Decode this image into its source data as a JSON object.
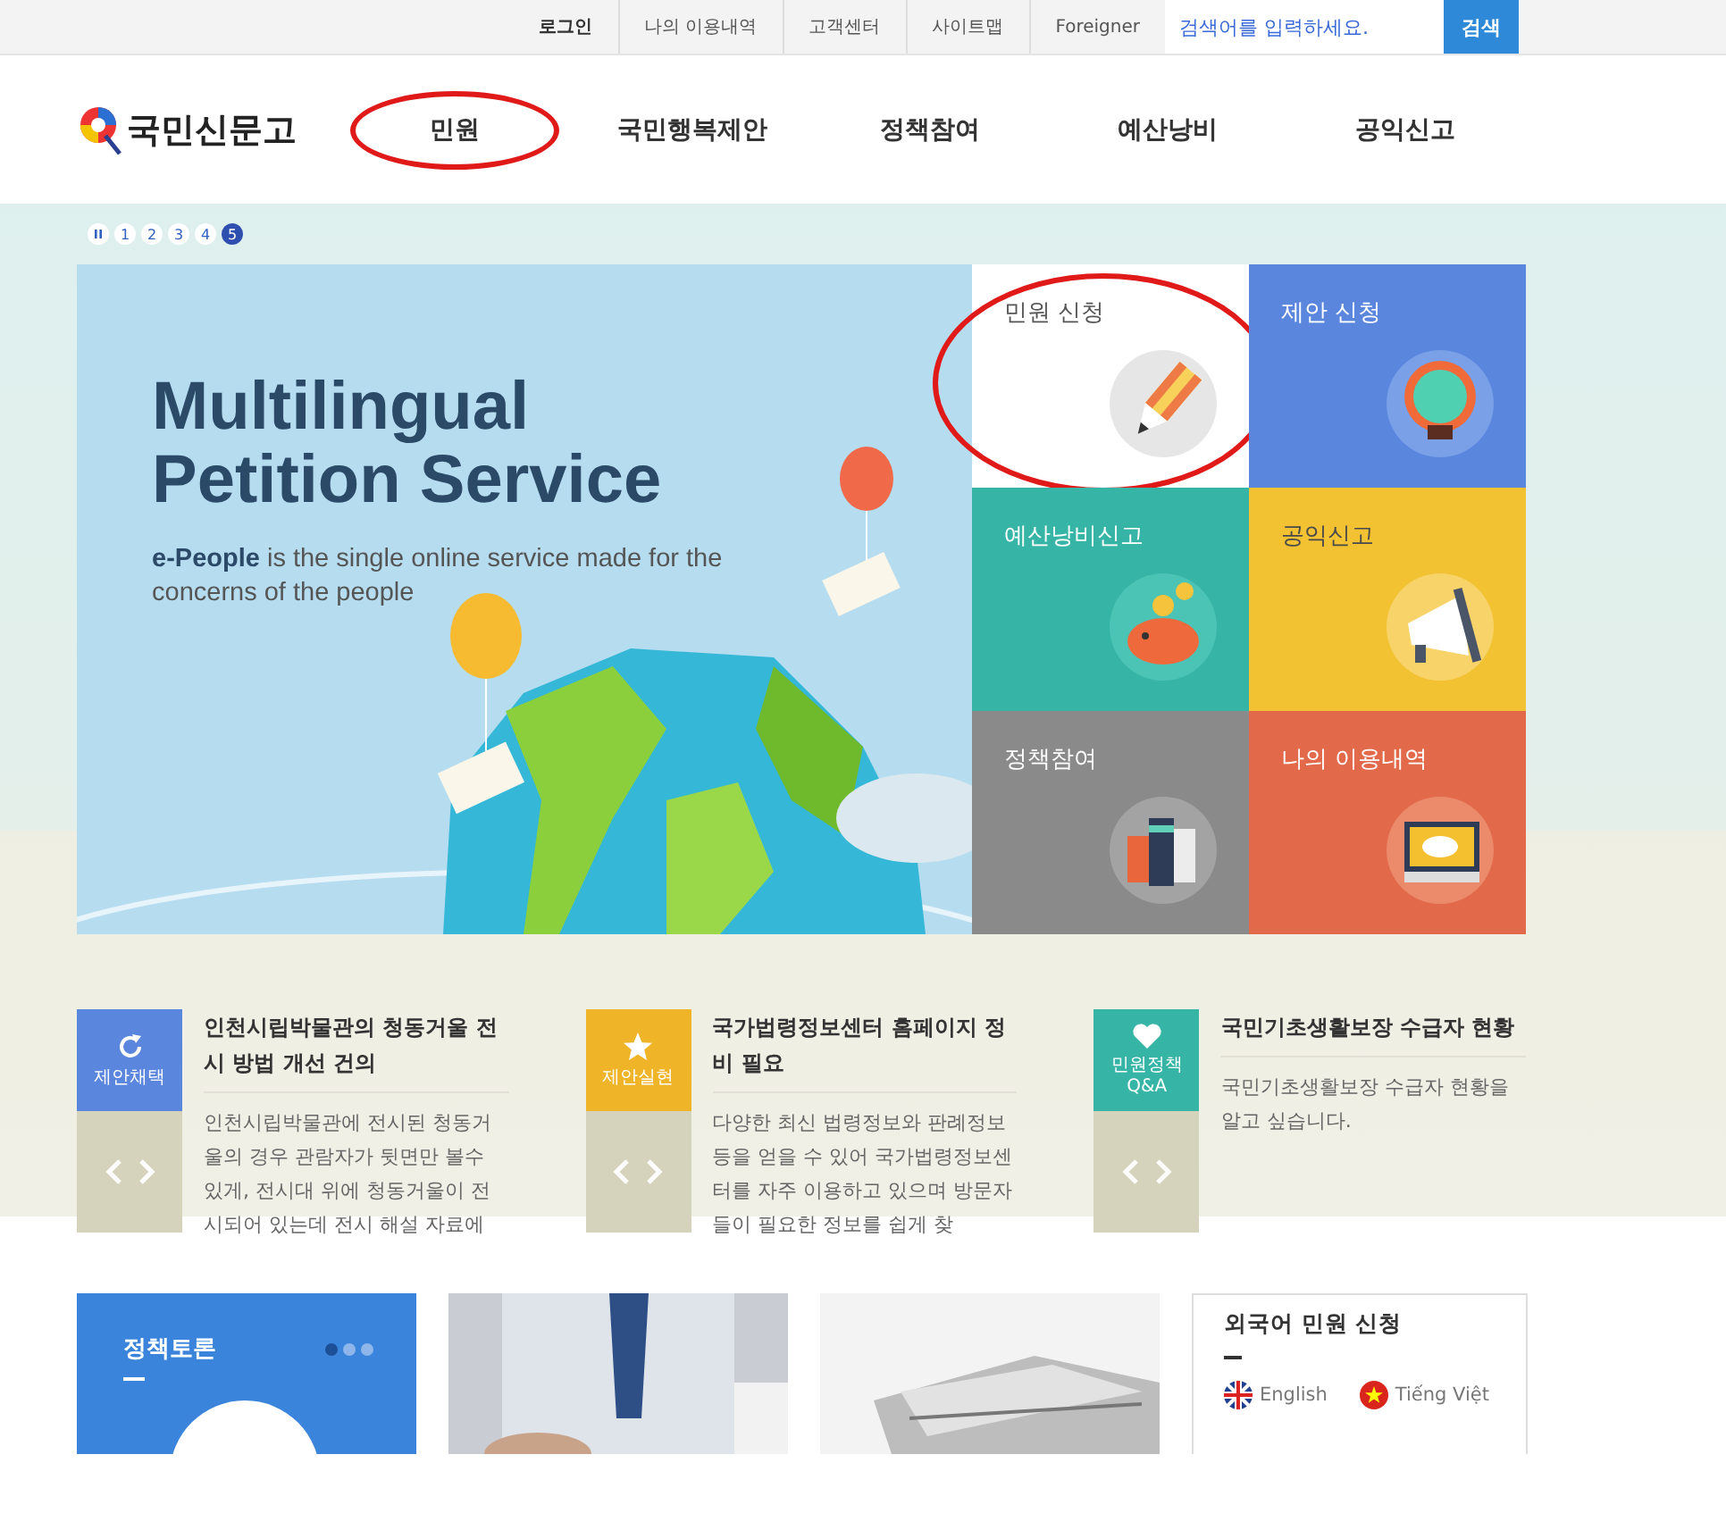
{
  "util_links": [
    "로그인",
    "나의 이용내역",
    "고객센터",
    "사이트맵",
    "Foreigner"
  ],
  "search": {
    "placeholder": "검색어를 입력하세요.",
    "button": "검색"
  },
  "logo": "국민신문고",
  "nav": [
    {
      "label": "민원",
      "highlighted": true
    },
    {
      "label": "국민행복제안",
      "highlighted": false
    },
    {
      "label": "정책참여",
      "highlighted": false
    },
    {
      "label": "예산낭비",
      "highlighted": false
    },
    {
      "label": "공익신고",
      "highlighted": false
    }
  ],
  "pager": [
    {
      "label": "1",
      "selected": false
    },
    {
      "label": "2",
      "selected": false
    },
    {
      "label": "3",
      "selected": false
    },
    {
      "label": "4",
      "selected": false
    },
    {
      "label": "5",
      "selected": true
    }
  ],
  "banner": {
    "title": "Multilingual Petition Service",
    "subtitle": "**e-People** is the single online service made for the concerns of the people"
  },
  "tiles": [
    {
      "label": "민원 신청",
      "kind": "pencil",
      "color": "#ffffff",
      "highlighted": true
    },
    {
      "label": "제안 신청",
      "kind": "bulb",
      "color": "#5b86dd",
      "highlighted": false
    },
    {
      "label": "예산낭비신고",
      "kind": "piggy",
      "color": "#36b4a5",
      "highlighted": false
    },
    {
      "label": "공익신고",
      "kind": "megaphone",
      "color": "#f2c232",
      "highlighted": false
    },
    {
      "label": "정책참여",
      "kind": "books",
      "color": "#8a8a8a",
      "highlighted": false
    },
    {
      "label": "나의 이용내역",
      "kind": "monitor",
      "color": "#e2694a",
      "highlighted": false
    }
  ],
  "news": [
    {
      "badge": "제안채택",
      "kind": "refresh",
      "color": "#5b86dd",
      "title": "인천시립박물관의 청동거울 전시 방법 개선 건의",
      "text": "인천시립박물관에 전시된 청동거울의 경우 관람자가 뒷면만 볼수 있게, 전시대 위에 청동거울이 전시되어 있는데 전시 해설 자료에"
    },
    {
      "badge": "제안실현",
      "kind": "star",
      "color": "#f0b429",
      "title": "국가법령정보센터 홈페이지 정비 필요",
      "text": "다양한 최신 법령정보와 판례정보 등을 얻을 수 있어 국가법령정보센터를 자주 이용하고 있으며 방문자들이 필요한 정보를 쉽게 찾"
    },
    {
      "badge": "민원정책 Q&A",
      "kind": "heart",
      "color": "#36b4a5",
      "title": "국민기초생활보장 수급자 현황",
      "text": "국민기초생활보장 수급자 현황을 알고 싶습니다."
    }
  ],
  "debate": {
    "title": "정책토론",
    "dots": [
      {
        "selected": true
      },
      {
        "selected": false
      },
      {
        "selected": false
      }
    ]
  },
  "foreign": {
    "title": "외국어 민원 신청",
    "languages": [
      {
        "label": "English",
        "kind": "uk"
      },
      {
        "label": "Tiếng Việt",
        "kind": "vn"
      }
    ]
  }
}
